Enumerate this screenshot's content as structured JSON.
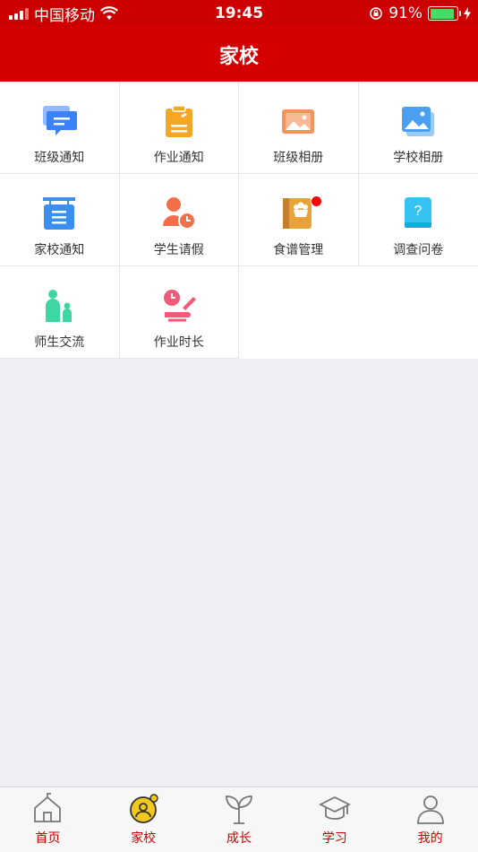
{
  "status_bar": {
    "carrier": "中国移动",
    "time": "19:45",
    "battery_percent": "91%",
    "battery_level": 0.91
  },
  "nav": {
    "title": "家校"
  },
  "grid": {
    "items": [
      {
        "label": "班级通知",
        "icon": "class-notice-icon",
        "color": "#3b82f6"
      },
      {
        "label": "作业通知",
        "icon": "homework-notice-icon",
        "color": "#f5a623"
      },
      {
        "label": "班级相册",
        "icon": "class-album-icon",
        "color": "#f4935a"
      },
      {
        "label": "学校相册",
        "icon": "school-album-icon",
        "color": "#4a9ff0"
      },
      {
        "label": "家校通知",
        "icon": "home-school-notice-icon",
        "color": "#3a8ff0"
      },
      {
        "label": "学生请假",
        "icon": "student-leave-icon",
        "color": "#f26f4a"
      },
      {
        "label": "食谱管理",
        "icon": "recipe-icon",
        "color": "#e8a23a",
        "badge": true
      },
      {
        "label": "调查问卷",
        "icon": "survey-icon",
        "color": "#35c3f2"
      },
      {
        "label": "师生交流",
        "icon": "teacher-student-icon",
        "color": "#3ed6a3"
      },
      {
        "label": "作业时长",
        "icon": "homework-time-icon",
        "color": "#f25a7a"
      }
    ]
  },
  "tab_bar": {
    "tabs": [
      {
        "label": "首页",
        "icon": "home-icon",
        "active": false
      },
      {
        "label": "家校",
        "icon": "home-school-icon",
        "active": true
      },
      {
        "label": "成长",
        "icon": "sprout-icon",
        "active": false
      },
      {
        "label": "学习",
        "icon": "graduation-cap-icon",
        "active": false
      },
      {
        "label": "我的",
        "icon": "user-icon",
        "active": false
      }
    ]
  }
}
